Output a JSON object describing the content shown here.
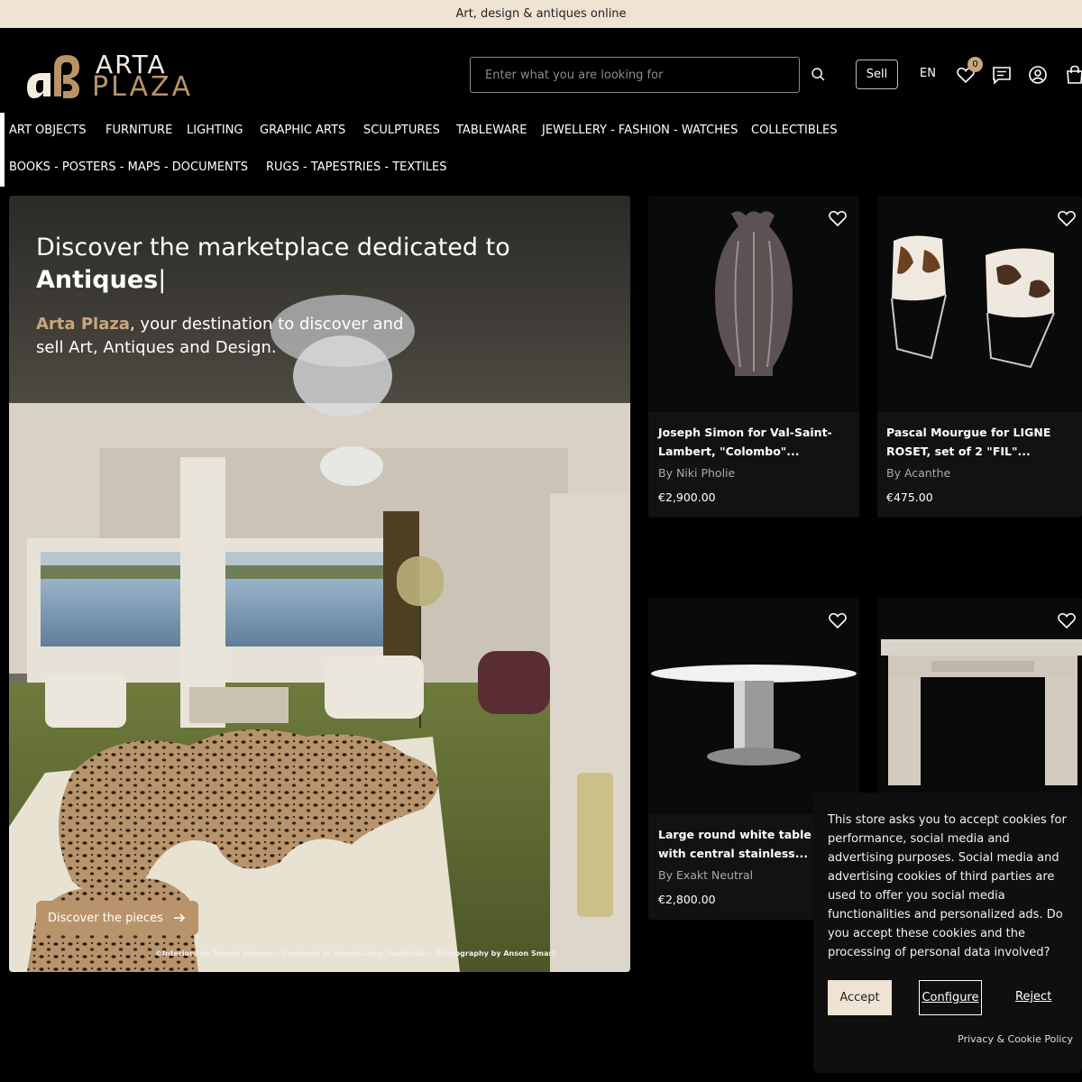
{
  "announcement": "Art, design & antiques online",
  "logo": {
    "line1": "ARTA",
    "line2": "PLAZA"
  },
  "header": {
    "search_placeholder": "Enter what you are looking for",
    "sell_label": "Sell",
    "language": "EN",
    "favorites_count": "0",
    "icons": [
      "search-icon",
      "heart-icon",
      "chat-icon",
      "user-icon",
      "cart-icon"
    ]
  },
  "nav": {
    "items": [
      "ART OBJECTS",
      "FURNITURE",
      "LIGHTING",
      "GRAPHIC ARTS",
      "SCULPTURES",
      "TABLEWARE",
      "JEWELLERY - FASHION - WATCHES",
      "COLLECTIBLES",
      "BOOKS - POSTERS - MAPS - DOCUMENTS",
      "RUGS - TAPESTRIES - TEXTILES"
    ]
  },
  "hero": {
    "title": "Discover the marketplace dedicated to",
    "typed_word": "Antiques",
    "cursor": "|",
    "brand": "Arta Plaza",
    "subtitle": ", your destination to discover and sell Art, Antiques and Design.",
    "button_label": "Discover the pieces",
    "credit": "©Interiors by Tamsin Johnson - Featured in VogueLiving (Australia) - Photography by Anson Smart"
  },
  "products": [
    {
      "title": "Joseph Simon for Val-Saint-Lambert, \"Colombo\"...",
      "seller": "By Niki Pholie",
      "price": "€2,900.00"
    },
    {
      "title": "Pascal Mourgue for LIGNE ROSET, set of 2 \"FIL\"...",
      "seller": "By Acanthe",
      "price": "€475.00"
    },
    {
      "title": "Large round white table with central stainless...",
      "seller": "By Exakt Neutral",
      "price": "€2,800.00"
    },
    {
      "title": "",
      "seller": "",
      "price": ""
    }
  ],
  "cookie": {
    "text": "This store asks you to accept cookies for performance, social media and advertising purposes. Social media and advertising cookies of third parties are used to offer you social media functionalities and personalized ads. Do you accept these cookies and the processing of personal data involved?",
    "accept_label": "Accept",
    "configure_label": "Configure",
    "reject_label": "Reject",
    "policy_label": "Privacy & Cookie Policy"
  },
  "colors": {
    "accent": "#b9946a",
    "announcement_bg": "#efe3d3",
    "background": "#000000"
  }
}
